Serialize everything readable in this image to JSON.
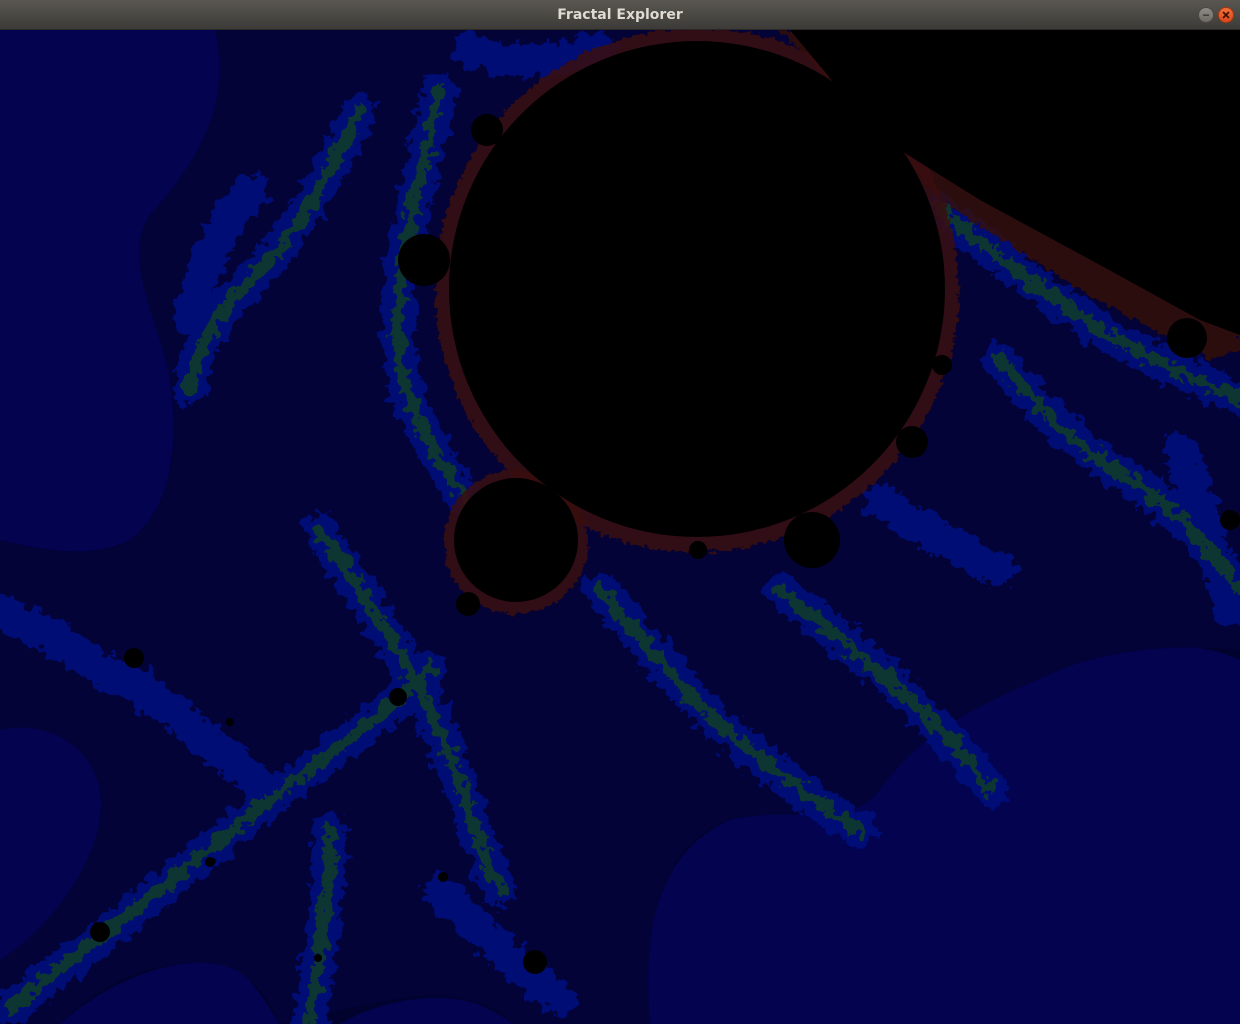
{
  "window": {
    "title": "Fractal Explorer",
    "minimize_icon": "minimize-icon",
    "close_icon": "close-icon"
  },
  "fractal": {
    "type": "mandelbrot",
    "colors": {
      "interior": "#000000",
      "outer_band": "#03034f",
      "inner_band": "#030338",
      "filament_blue": "#050a7a",
      "filament_green": "#0f3a2a",
      "edge_red": "#3a0a08"
    }
  }
}
